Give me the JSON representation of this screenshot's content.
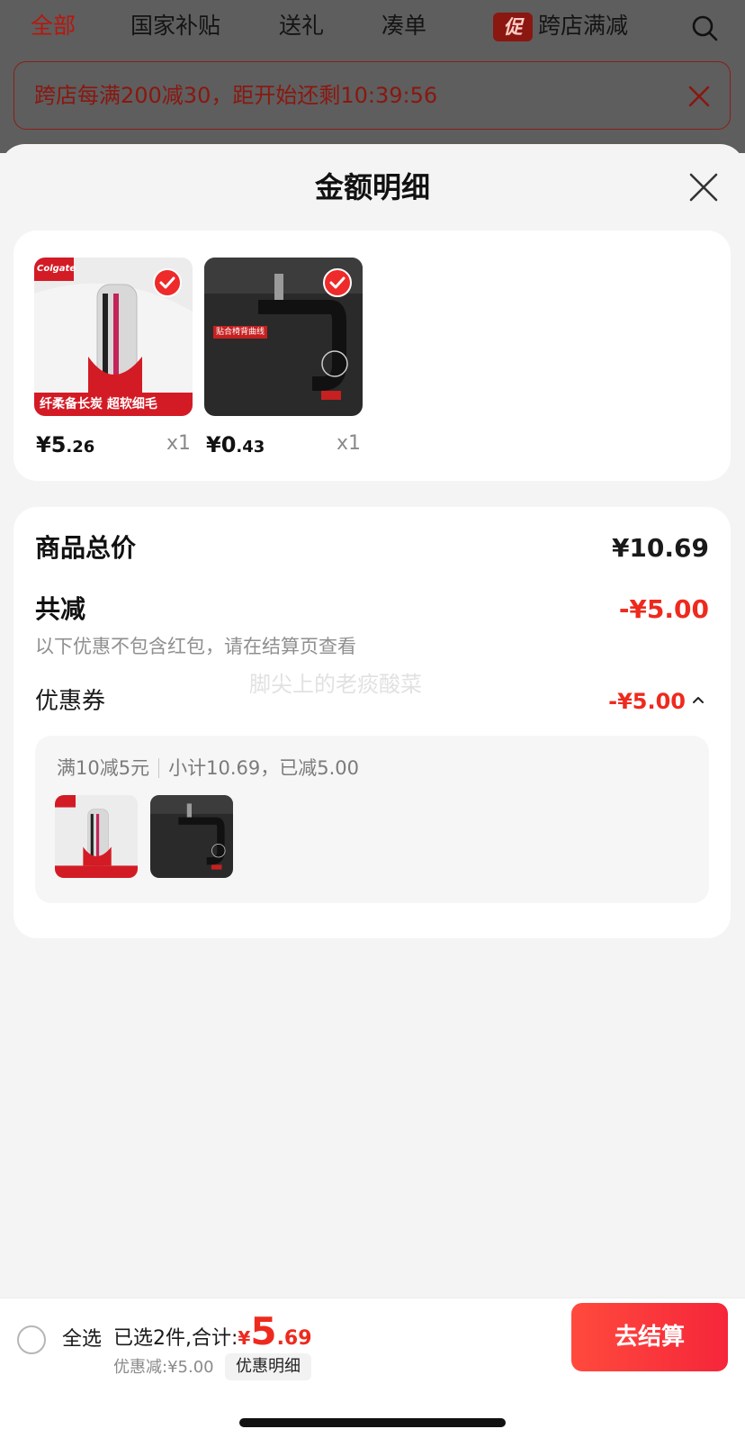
{
  "top_tabs": [
    {
      "label": "全部",
      "active": true
    },
    {
      "label": "国家补贴",
      "active": false
    },
    {
      "label": "送礼",
      "active": false
    },
    {
      "label": "凑单",
      "active": false
    },
    {
      "label": "跨店满减",
      "active": false,
      "badge": "促"
    }
  ],
  "banner": {
    "text": "跨店每满200减30，距开始还剩10:39:56"
  },
  "sheet": {
    "title": "金额明细"
  },
  "products": [
    {
      "price_currency": "¥",
      "price_int": "5",
      "price_dec": ".26",
      "qty": "x1",
      "selected": true,
      "image_caption": "纤柔备长炭 超软细毛",
      "brand": "Colgate"
    },
    {
      "price_currency": "¥",
      "price_int": "0",
      "price_dec": ".43",
      "qty": "x1",
      "selected": true,
      "image_caption": "贴合椅背曲线"
    }
  ],
  "detail": {
    "total_label": "商品总价",
    "total_value": "¥10.69",
    "discount_label": "共减",
    "discount_value": "-¥5.00",
    "note": "以下优惠不包含红包，请在结算页查看",
    "watermark": "脚尖上的老痰酸菜",
    "coupon_label": "优惠券",
    "coupon_value": "-¥5.00",
    "coupon_rule": "满10减5元",
    "coupon_subtotal": "小计10.69，已减5.00"
  },
  "bottom_bar": {
    "select_all_label": "全选",
    "summary_prefix": "已选2件,合计:",
    "total_currency": "¥",
    "total_int": "5",
    "total_dec": ".69",
    "saved_text": "优惠减:¥5.00",
    "detail_chip": "优惠明细",
    "checkout_label": "去结算"
  },
  "colors": {
    "accent_red": "#ee2a1e",
    "active_tab": "#b8170e"
  }
}
